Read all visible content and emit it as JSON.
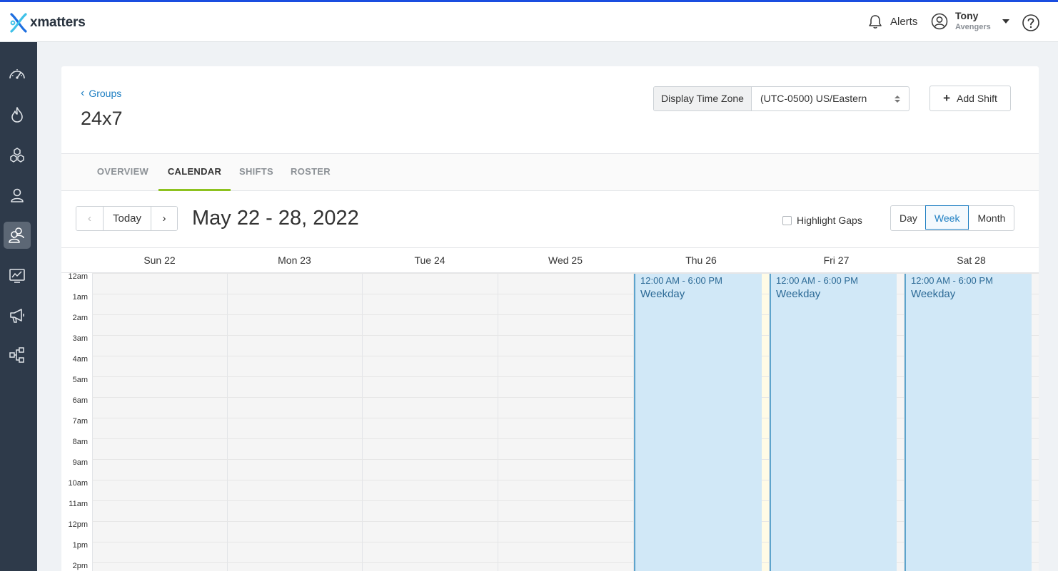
{
  "app": {
    "logo_text": "xmatters"
  },
  "header": {
    "alerts_label": "Alerts",
    "user_name": "Tony",
    "user_team": "Avengers"
  },
  "sidebar": {
    "items": [
      {
        "name": "dashboard",
        "active": false
      },
      {
        "name": "incidents",
        "active": false
      },
      {
        "name": "services",
        "active": false
      },
      {
        "name": "users",
        "active": false
      },
      {
        "name": "groups",
        "active": true
      },
      {
        "name": "reports",
        "active": false
      },
      {
        "name": "messaging",
        "active": false
      },
      {
        "name": "workflows",
        "active": false
      }
    ]
  },
  "page": {
    "breadcrumb": "Groups",
    "title": "24x7",
    "timezone_label": "Display Time Zone",
    "timezone_value": "(UTC-0500) US/Eastern",
    "add_shift_label": "Add Shift"
  },
  "tabs": [
    {
      "label": "OVERVIEW",
      "active": false
    },
    {
      "label": "CALENDAR",
      "active": true
    },
    {
      "label": "SHIFTS",
      "active": false
    },
    {
      "label": "ROSTER",
      "active": false
    }
  ],
  "calendar": {
    "prev_label": "‹",
    "today_label": "Today",
    "next_label": "›",
    "date_range": "May 22 - 28, 2022",
    "highlight_gaps_label": "Highlight Gaps",
    "views": [
      {
        "label": "Day",
        "active": false
      },
      {
        "label": "Week",
        "active": true
      },
      {
        "label": "Month",
        "active": false
      }
    ],
    "days": [
      "Sun 22",
      "Mon 23",
      "Tue 24",
      "Wed 25",
      "Thu 26",
      "Fri 27",
      "Sat 28"
    ],
    "hours": [
      "12am",
      "1am",
      "2am",
      "3am",
      "4am",
      "5am",
      "6am",
      "7am",
      "8am",
      "9am",
      "10am",
      "11am",
      "12pm",
      "1pm",
      "2pm"
    ],
    "shifts": [
      {
        "day": "Thu 26",
        "time": "12:00 AM - 6:00 PM",
        "name": "Weekday"
      },
      {
        "day": "Fri 27",
        "time": "12:00 AM - 6:00 PM",
        "name": "Weekday"
      },
      {
        "day": "Sat 28",
        "time": "12:00 AM - 6:00 PM",
        "name": "Weekday"
      }
    ]
  }
}
